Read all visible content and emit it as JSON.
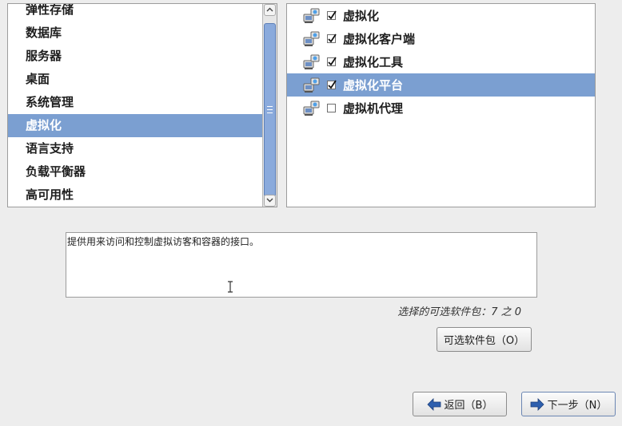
{
  "categories": {
    "items": [
      {
        "label": "弹性存储"
      },
      {
        "label": "数据库"
      },
      {
        "label": "服务器"
      },
      {
        "label": "桌面"
      },
      {
        "label": "系统管理"
      },
      {
        "label": "虚拟化",
        "selected": true
      },
      {
        "label": "语言支持"
      },
      {
        "label": "负载平衡器"
      },
      {
        "label": "高可用性"
      }
    ]
  },
  "packages": {
    "items": [
      {
        "label": "虚拟化",
        "checked": true
      },
      {
        "label": "虚拟化客户端",
        "checked": true
      },
      {
        "label": "虚拟化工具",
        "checked": true
      },
      {
        "label": "虚拟化平台",
        "checked": true,
        "selected": true
      },
      {
        "label": "虚拟机代理",
        "checked": false
      }
    ]
  },
  "description": {
    "text": "提供用来访问和控制虚拟访客和容器的接口。"
  },
  "optional_count": {
    "text": "选择的可选软件包：7 之 0"
  },
  "buttons": {
    "optional_packages": "可选软件包（O）",
    "back": "返回（B）",
    "next": "下一步（N）"
  },
  "colors": {
    "selection": "#7b9fd1",
    "scroll_thumb": "#8aaadc",
    "background": "#ededed"
  }
}
